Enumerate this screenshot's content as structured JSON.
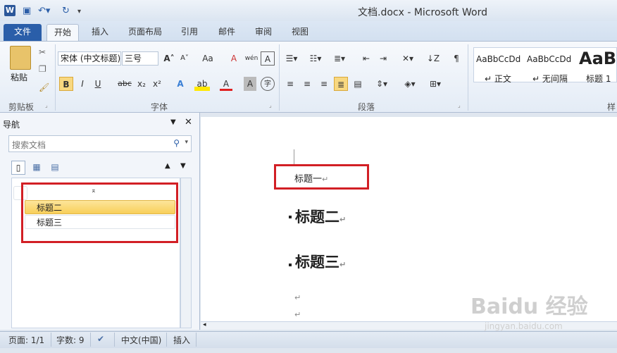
{
  "window": {
    "title": "文档.docx - Microsoft Word",
    "app_icon": "W"
  },
  "tabs": [
    "文件",
    "开始",
    "插入",
    "页面布局",
    "引用",
    "邮件",
    "审阅",
    "视图"
  ],
  "ribbon": {
    "clipboard": {
      "paste": "粘贴",
      "label": "剪贴板"
    },
    "font": {
      "name": "宋体 (中文标题)",
      "size": "三号",
      "label": "字体",
      "bold": "B",
      "italic": "I",
      "underline": "U",
      "strike": "abc",
      "sub": "x₂",
      "sup": "x²",
      "effect": "A",
      "highlight": "ab",
      "color": "A",
      "enclose": "字",
      "grow": "A˄",
      "shrink": "A˅",
      "case": "Aa",
      "clear": "A",
      "phonetic": "wén",
      "border": "A"
    },
    "paragraph": {
      "label": "段落"
    },
    "styles": [
      {
        "preview": "AaBbCcDd",
        "name": "↵ 正文"
      },
      {
        "preview": "AaBbCcDd",
        "name": "↵ 无间隔"
      },
      {
        "preview": "AaBb",
        "name": "标题 1"
      }
    ],
    "styles_label": "样"
  },
  "nav": {
    "title": "导航",
    "search_placeholder": "搜索文档",
    "items": [
      "标题二",
      "标题三"
    ]
  },
  "document": {
    "h1": "标题一",
    "h2": "标题二",
    "h3": "标题三",
    "para_mark": "↵"
  },
  "status": {
    "page": "页面: 1/1",
    "words": "字数: 9",
    "lang": "中文(中国)",
    "mode": "插入"
  },
  "watermark": {
    "logo": "Baidu 经验",
    "url": "jingyan.baidu.com"
  }
}
